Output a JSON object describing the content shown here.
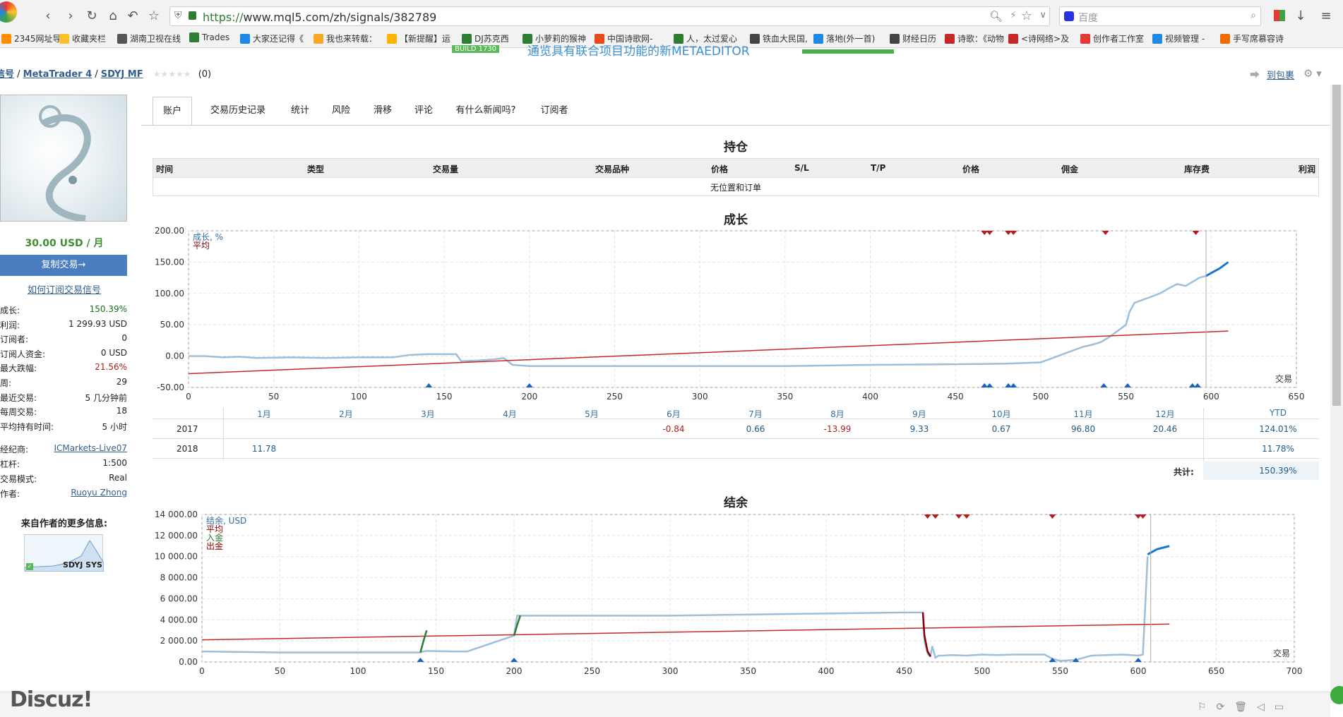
{
  "browser": {
    "url_https": "https://",
    "url_rest": "www.mql5.com/zh/signals/382789",
    "search_placeholder": "百度",
    "bookmarks": [
      "2345网址导",
      "收藏夹栏",
      "湖南卫视在线",
      "Trades",
      "大家还记得《",
      "我也来转载：",
      "【新提醒】运",
      "DJ苏克西",
      "小萝莉的猴神",
      "中国诗歌网-",
      "人，太过爱心",
      "铁血大民国,",
      "落地(外一首)",
      "财经日历",
      "诗歌：《动物",
      "<诗网络>及",
      "创作者工作室",
      "视频管理 -",
      "手写席慕容诗"
    ]
  },
  "banner": {
    "build": "BUILD 1730",
    "text": "通览具有联合项目功能的新METAEDITOR"
  },
  "breadcrumb": {
    "a": "信号",
    "b": "MetaTrader 4",
    "c": "SDYJ MF",
    "rating": "(0)"
  },
  "header_right": {
    "link": "到包裹"
  },
  "sidebar": {
    "price": "30.00 USD / 月",
    "copy_button": "复制交易→",
    "howto_link": "如何订阅交易信号",
    "stats": [
      {
        "k": "成长:",
        "v": "150.39%",
        "color": "#1a6e1a"
      },
      {
        "k": "利润:",
        "v": "1 299.93 USD",
        "color": "#222"
      },
      {
        "k": "订阅者:",
        "v": "0",
        "color": "#222"
      },
      {
        "k": "订阅人资金:",
        "v": "0 USD",
        "color": "#222"
      },
      {
        "k": "最大跌幅:",
        "v": "21.56%",
        "color": "#b02020"
      },
      {
        "k": "周:",
        "v": "29",
        "color": "#222"
      },
      {
        "k": "最近交易:",
        "v": "5 几分钟前",
        "color": "#222"
      },
      {
        "k": "每周交易:",
        "v": "18",
        "color": "#222"
      },
      {
        "k": "平均持有时间:",
        "v": "5 小时",
        "color": "#222"
      }
    ],
    "info": [
      {
        "k": "经纪商:",
        "v": "ICMarkets-Live07",
        "link": true
      },
      {
        "k": "杠杆:",
        "v": "1:500",
        "link": false
      },
      {
        "k": "交易模式:",
        "v": "Real",
        "link": false
      },
      {
        "k": "作者:",
        "v": "Ruoyu Zhong",
        "link": true
      }
    ],
    "more_title": "来自作者的更多信息:",
    "thumb_label": "SDYJ SYS"
  },
  "tabs": [
    "账户",
    "交易历史记录",
    "统计",
    "风险",
    "滑移",
    "评论",
    "有什么新闻吗?",
    "订阅者"
  ],
  "positions": {
    "title": "持仓",
    "headers": [
      "时间",
      "类型",
      "交易量",
      "交易品种",
      "价格",
      "S/L",
      "T/P",
      "价格",
      "佣金",
      "库存费",
      "利润"
    ],
    "empty": "无位置和订单"
  },
  "growth": {
    "title": "成长",
    "legend": [
      "成长, %",
      "平均"
    ],
    "xlabel": "交易",
    "months": [
      "1月",
      "2月",
      "3月",
      "4月",
      "5月",
      "6月",
      "7月",
      "8月",
      "9月",
      "10月",
      "11月",
      "12月"
    ],
    "ytd": "YTD",
    "years": [
      {
        "year": "2017",
        "values": [
          "",
          "",
          "",
          "",
          "",
          "-0.84",
          "0.66",
          "-13.99",
          "9.33",
          "0.67",
          "96.80",
          "20.46"
        ],
        "ytd": "124.01%"
      },
      {
        "year": "2018",
        "values": [
          "11.78",
          "",
          "",
          "",
          "",
          "",
          "",
          "",
          "",
          "",
          "",
          ""
        ],
        "ytd": "11.78%"
      }
    ],
    "total_label": "共计:",
    "total": "150.39%"
  },
  "balance": {
    "title": "结余",
    "legend": [
      "结余, USD",
      "平均",
      "入金",
      "出金"
    ],
    "xlabel": "交易"
  },
  "footer": {
    "logo": "Discuz!"
  },
  "chart_data": [
    {
      "type": "line",
      "title": "成长",
      "xlabel": "交易",
      "xlim": [
        0,
        650
      ],
      "ylim": [
        -50,
        200
      ],
      "x_ticks": [
        0,
        50,
        100,
        150,
        200,
        250,
        300,
        350,
        400,
        450,
        500,
        550,
        600,
        650
      ],
      "y_ticks": [
        -50,
        0,
        50,
        100,
        150,
        200
      ],
      "series": [
        {
          "name": "成长, %",
          "x": [
            0,
            10,
            20,
            30,
            40,
            60,
            80,
            100,
            120,
            130,
            140,
            150,
            157,
            160,
            170,
            180,
            185,
            190,
            200,
            250,
            300,
            350,
            400,
            450,
            480,
            490,
            500,
            505,
            510,
            520,
            525,
            530,
            535,
            540,
            545,
            550,
            552,
            555,
            560,
            565,
            570,
            575,
            580,
            585,
            590,
            593,
            597
          ],
          "y": [
            0,
            0,
            -2,
            -1,
            -3,
            -2,
            -3,
            -2,
            -2,
            2,
            3,
            3,
            3,
            -8,
            -7,
            -5,
            -3,
            -14,
            -16,
            -16,
            -16,
            -16,
            -14,
            -13,
            -12,
            -11,
            -10,
            -5,
            0,
            10,
            15,
            18,
            22,
            30,
            40,
            50,
            70,
            85,
            90,
            95,
            100,
            108,
            115,
            112,
            120,
            125,
            128
          ],
          "color": "#9cbfdc"
        },
        {
          "name": "",
          "x": [
            597,
            605,
            610
          ],
          "y": [
            128,
            140,
            150
          ],
          "color": "#1976d2"
        },
        {
          "name": "平均",
          "x": [
            0,
            610
          ],
          "y": [
            -28,
            40
          ],
          "color": "#c62828"
        }
      ]
    },
    {
      "type": "line",
      "title": "结余",
      "xlabel": "交易",
      "xlim": [
        0,
        700
      ],
      "ylim": [
        0,
        14000
      ],
      "x_ticks": [
        0,
        50,
        100,
        150,
        200,
        250,
        300,
        350,
        400,
        450,
        500,
        550,
        600,
        650,
        700
      ],
      "y_ticks": [
        0,
        2000,
        4000,
        6000,
        8000,
        10000,
        12000,
        14000
      ],
      "series": [
        {
          "name": "结余, USD",
          "x": [
            0,
            50,
            100,
            140,
            142,
            144,
            160,
            170,
            200,
            202,
            205,
            250,
            300,
            350,
            400,
            450,
            462,
            463,
            465,
            466,
            467,
            468,
            470,
            472,
            475,
            480,
            490,
            500,
            510,
            520,
            540,
            545,
            550,
            560,
            570,
            580,
            590,
            600,
            603,
            606
          ],
          "y": [
            1000,
            900,
            900,
            900,
            1000,
            1050,
            1000,
            1000,
            2500,
            4400,
            4400,
            4400,
            4400,
            4500,
            4600,
            4700,
            4700,
            2000,
            800,
            600,
            700,
            1500,
            400,
            600,
            600,
            650,
            600,
            700,
            650,
            700,
            700,
            300,
            100,
            200,
            600,
            650,
            700,
            600,
            700,
            10000
          ],
          "color": "#9cbfdc"
        },
        {
          "name": "",
          "x": [
            606,
            612,
            620
          ],
          "y": [
            10200,
            10700,
            11000
          ],
          "color": "#1976d2"
        },
        {
          "name": "平均",
          "x": [
            0,
            620
          ],
          "y": [
            2100,
            3600
          ],
          "color": "#c62828"
        },
        {
          "name": "入金",
          "x": [
            140,
            142,
            144
          ],
          "y": [
            900,
            2000,
            3000
          ],
          "color": "#2e7d32"
        },
        {
          "name": "入金",
          "x": [
            200,
            202,
            204
          ],
          "y": [
            2500,
            3500,
            4400
          ],
          "color": "#2e7d32"
        },
        {
          "name": "出金",
          "x": [
            462,
            463,
            465,
            467
          ],
          "y": [
            4700,
            2500,
            1000,
            500
          ],
          "color": "#8b0000"
        }
      ]
    }
  ]
}
